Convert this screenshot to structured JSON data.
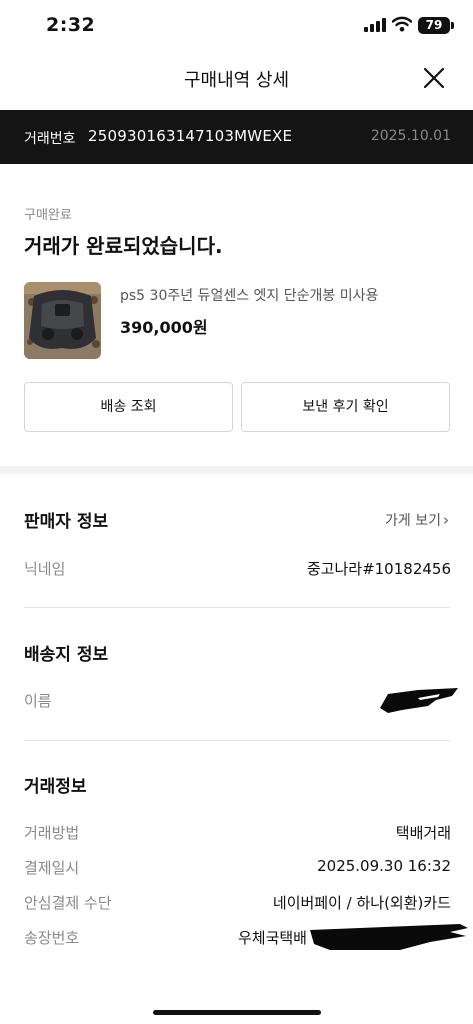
{
  "status_bar": {
    "time": "2:32",
    "battery": "79"
  },
  "header": {
    "title": "구매내역 상세"
  },
  "transaction": {
    "label": "거래번호",
    "number": "250930163147103MWEXE",
    "date": "2025.10.01"
  },
  "purchase": {
    "status_small": "구매완료",
    "status_main": "거래가 완료되었습니다.",
    "product_name": "ps5 30주년 듀얼센스 엣지 단순개봉 미사용",
    "product_price": "390,000원"
  },
  "buttons": {
    "shipping": "배송 조회",
    "review": "보낸 후기 확인"
  },
  "seller": {
    "title": "판매자 정보",
    "store_link": "가게 보기",
    "nickname_label": "닉네임",
    "nickname_value": "중고나라#10182456"
  },
  "shipping": {
    "title": "배송지 정보",
    "name_label": "이름"
  },
  "trade": {
    "title": "거래정보",
    "rows": [
      {
        "label": "거래방법",
        "value": "택배거래"
      },
      {
        "label": "결제일시",
        "value": "2025.09.30 16:32"
      },
      {
        "label": "안심결제 수단",
        "value": "네이버페이 / 하나(외환)카드"
      },
      {
        "label": "송장번호",
        "value": "우체국택배"
      }
    ]
  },
  "colors": {
    "dark_bar": "#141414",
    "muted_text": "#8a8a8a",
    "divider": "#e4e4e4"
  }
}
